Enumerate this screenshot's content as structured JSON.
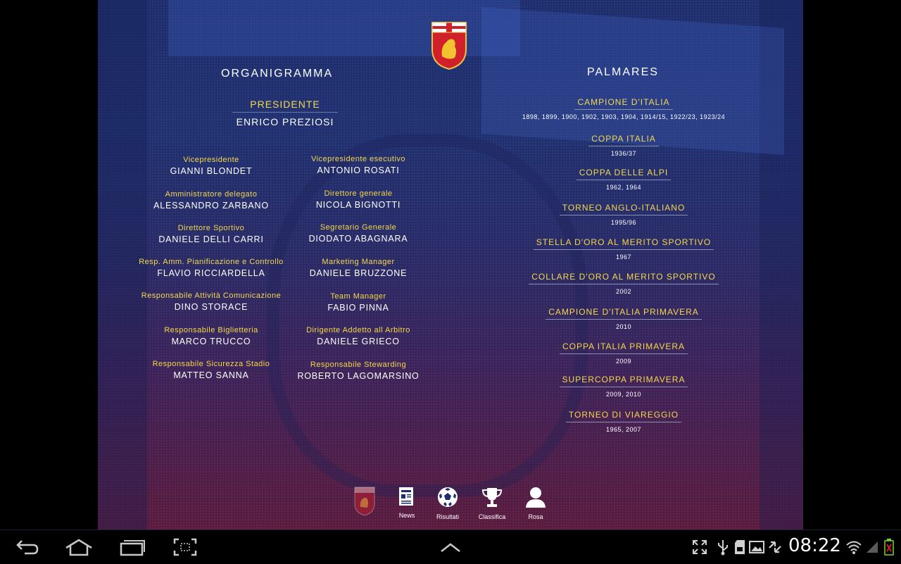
{
  "organigramma": {
    "heading": "ORGANIGRAMMA",
    "president": {
      "title": "PRESIDENTE",
      "name": "ENRICO PREZIOSI"
    },
    "left": [
      {
        "role": "Vicepresidente",
        "name": "GIANNI BLONDET"
      },
      {
        "role": "Amministratore delegato",
        "name": "ALESSANDRO ZARBANO"
      },
      {
        "role": "Direttore Sportivo",
        "name": "DANIELE DELLI CARRI"
      },
      {
        "role": "Resp. Amm. Pianificazione e Controllo",
        "name": "FLAVIO RICCIARDELLA"
      },
      {
        "role": "Responsabile  Attività Comunicazione",
        "name": "DINO STORACE"
      },
      {
        "role": "Responsabile Biglietteria",
        "name": "MARCO TRUCCO"
      },
      {
        "role": "Responsabile Sicurezza Stadio",
        "name": "MATTEO SANNA"
      }
    ],
    "right": [
      {
        "role": "Vicepresidente esecutivo",
        "name": "ANTONIO ROSATI"
      },
      {
        "role": "Direttore generale",
        "name": "NICOLA BIGNOTTI"
      },
      {
        "role": "Segretario Generale",
        "name": "DIODATO ABAGNARA"
      },
      {
        "role": "Marketing Manager",
        "name": "DANIELE BRUZZONE"
      },
      {
        "role": "Team Manager",
        "name": "FABIO PINNA"
      },
      {
        "role": "Dirigente Addetto all Arbitro",
        "name": "DANIELE GRIECO"
      },
      {
        "role": "Responsabile Stewarding",
        "name": "ROBERTO LAGOMARSINO"
      }
    ]
  },
  "palmares": {
    "heading": "PALMARES",
    "items": [
      {
        "title": "CAMPIONE D'ITALIA",
        "years": "1898, 1899, 1900, 1902, 1903, 1904, 1914/15, 1922/23, 1923/24"
      },
      {
        "title": "COPPA ITALIA",
        "years": "1936/37"
      },
      {
        "title": "COPPA DELLE ALPI",
        "years": "1962, 1964"
      },
      {
        "title": "TORNEO ANGLO-ITALIANO",
        "years": "1995/96"
      },
      {
        "title": "STELLA D'ORO AL MERITO SPORTIVO",
        "years": "1967"
      },
      {
        "title": "COLLARE D'ORO AL MERITO SPORTIVO",
        "years": "2002"
      },
      {
        "title": "CAMPIONE D'ITALIA PRIMAVERA",
        "years": "2010"
      },
      {
        "title": "COPPA ITALIA PRIMAVERA",
        "years": "2009"
      },
      {
        "title": "SUPERCOPPA PRIMAVERA",
        "years": "2009, 2010"
      },
      {
        "title": "TORNEO DI VIAREGGIO",
        "years": "1965, 2007"
      }
    ]
  },
  "bottom_nav": {
    "items": [
      {
        "icon": "club-crest-icon",
        "label": ""
      },
      {
        "icon": "news-icon",
        "label": "News"
      },
      {
        "icon": "football-icon",
        "label": "Risultati"
      },
      {
        "icon": "trophy-icon",
        "label": "Classifica"
      },
      {
        "icon": "person-icon",
        "label": "Rosa"
      }
    ]
  },
  "system_bar": {
    "time": "08:22",
    "icons": [
      "back-icon",
      "home-icon",
      "recent-apps-icon",
      "screenshot-icon",
      "up-arrow-icon",
      "fullscreen-icon",
      "usb-icon",
      "sd-card-icon",
      "image-icon",
      "sync-icon",
      "wifi-icon",
      "signal-icon",
      "battery-icon"
    ]
  },
  "colors": {
    "accent": "#f5d84a",
    "text": "#ffffff",
    "bg_top": "#1d2d6e",
    "bg_bottom": "#5a1b3e",
    "crest_red": "#d0202a"
  }
}
